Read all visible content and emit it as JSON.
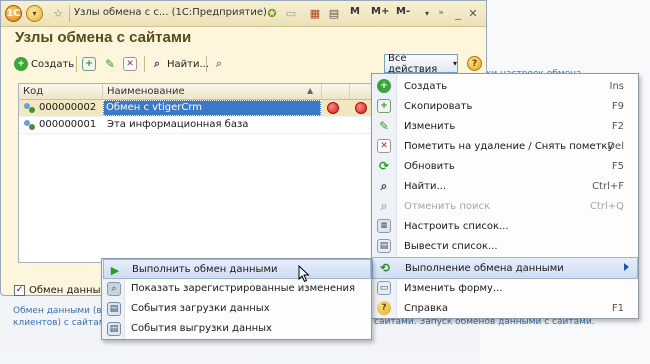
{
  "window": {
    "title": "Узлы обмена с с...  (1С:Предприятие)",
    "memory_buttons": [
      "M",
      "M+",
      "M-"
    ]
  },
  "page": {
    "title": "Узлы обмена с сайтами"
  },
  "toolbar": {
    "create_label": "Создать",
    "find_label": "Найти...",
    "all_actions_label": "Все действия",
    "help_label": "?"
  },
  "table": {
    "headers": {
      "code": "Код",
      "name": "Наименование"
    },
    "rows": [
      {
        "code": "000000002",
        "name": "Обмен с vtigerCrm",
        "selected": true
      },
      {
        "code": "000000001",
        "name": "Эта информационная база",
        "selected": false
      }
    ]
  },
  "footer": {
    "checkbox_label": "Обмен данными",
    "checkbox_checked": true,
    "desc_line1": "Обмен данными (вы",
    "desc_line2": "клиентов) с сайтам",
    "desc_right": "сайтами. Запуск обменов данными с сайтами.",
    "bg_link_text": "ки настроек обмена"
  },
  "menu": {
    "items": [
      {
        "label": "Создать",
        "shortcut": "Ins",
        "icon": "create-icon",
        "disabled": false
      },
      {
        "label": "Скопировать",
        "shortcut": "F9",
        "icon": "copy-icon",
        "disabled": false
      },
      {
        "label": "Изменить",
        "shortcut": "F2",
        "icon": "edit-icon",
        "disabled": false
      },
      {
        "label": "Пометить на удаление / Снять пометку",
        "shortcut": "Del",
        "icon": "delete-mark-icon",
        "disabled": false
      },
      {
        "label": "Обновить",
        "shortcut": "F5",
        "icon": "refresh-icon",
        "disabled": false
      },
      {
        "label": "Найти...",
        "shortcut": "Ctrl+F",
        "icon": "find-icon",
        "disabled": false
      },
      {
        "label": "Отменить поиск",
        "shortcut": "Ctrl+Q",
        "icon": "cancel-search-icon",
        "disabled": true
      },
      {
        "label": "Настроить список...",
        "shortcut": "",
        "icon": "list-settings-icon",
        "disabled": false
      },
      {
        "label": "Вывести список...",
        "shortcut": "",
        "icon": "print-list-icon",
        "disabled": false
      },
      {
        "label": "Выполнение обмена данными",
        "shortcut": "",
        "icon": "exchange-icon",
        "disabled": false,
        "submenu": true
      },
      {
        "label": "Изменить форму...",
        "shortcut": "",
        "icon": "change-form-icon",
        "disabled": false
      },
      {
        "label": "Справка",
        "shortcut": "F1",
        "icon": "help-icon",
        "disabled": false
      }
    ]
  },
  "submenu": {
    "items": [
      {
        "label": "Выполнить обмен данными",
        "icon": "play-icon"
      },
      {
        "label": "Показать зарегистрированные изменения",
        "icon": "changes-icon"
      },
      {
        "label": "События загрузки данных",
        "icon": "load-events-icon"
      },
      {
        "label": "События выгрузки данных",
        "icon": "unload-events-icon"
      }
    ]
  },
  "colors": {
    "accent": "#3d79c9",
    "title": "#5a4a18",
    "highlight": "#cfdcf2"
  }
}
